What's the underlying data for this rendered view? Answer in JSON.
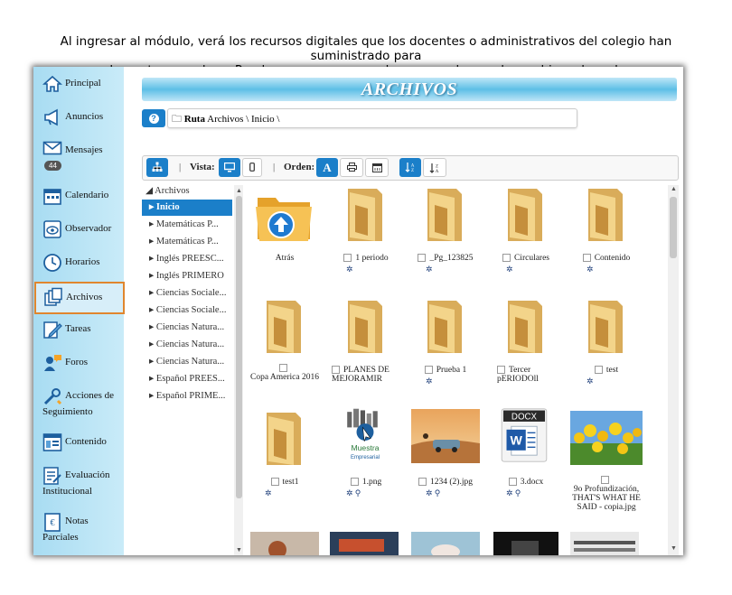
{
  "caption": {
    "line1": "Al ingresar al módulo, verá los recursos digitales que los docentes o administrativos del colegio han suministrado para",
    "line2": "complementar una clase. Puede navegar por sus clases, para buscar los archivos de cada una."
  },
  "sidebar": {
    "items": [
      {
        "label": "Principal",
        "icon": "home-icon"
      },
      {
        "label": "Anuncios",
        "icon": "megaphone-icon"
      },
      {
        "label": "Mensajes",
        "icon": "envelope-icon",
        "badge": "44"
      },
      {
        "label": "Calendario",
        "icon": "calendar-icon"
      },
      {
        "label": "Observador",
        "icon": "eye-icon"
      },
      {
        "label": "Horarios",
        "icon": "clock-icon"
      },
      {
        "label": "Archivos",
        "icon": "files-icon"
      },
      {
        "label": "Tareas",
        "icon": "pencil-icon"
      },
      {
        "label": "Foros",
        "icon": "forum-icon"
      },
      {
        "label": "Acciones de",
        "label2": "Seguimiento",
        "icon": "tools-icon"
      },
      {
        "label": "Contenido",
        "icon": "content-icon"
      },
      {
        "label": "Evaluación",
        "label2": "Institucional",
        "icon": "evaluation-icon"
      },
      {
        "label": "Notas",
        "label2": "Parciales",
        "icon": "grades-icon"
      }
    ]
  },
  "header": {
    "title": "ARCHIVOS"
  },
  "breadcrumb": {
    "label": "Ruta",
    "path": "Archivos \\ Inicio \\"
  },
  "toolbar": {
    "vista_label": "Vista:",
    "orden_label": "Orden:",
    "order_a": "A"
  },
  "tree": {
    "root": "Archivos",
    "items": [
      "Inicio",
      "Matemáticas P...",
      "Matemáticas P...",
      "Inglés PREESC...",
      "Inglés PRIMERO",
      "Ciencias Sociale...",
      "Ciencias Sociale...",
      "Ciencias Natura...",
      "Ciencias Natura...",
      "Ciencias Natura...",
      "Español PREES...",
      "Español PRIME..."
    ]
  },
  "files": [
    {
      "name": "Atrás",
      "kind": "back"
    },
    {
      "name": "1 periodo",
      "kind": "folder"
    },
    {
      "name": "_Pg_123825",
      "kind": "folder"
    },
    {
      "name": "Circulares",
      "kind": "folder"
    },
    {
      "name": "Contenido",
      "kind": "folder"
    },
    {
      "name": "Copa America 2016",
      "kind": "folder"
    },
    {
      "name": "PLANES DE MEJORAMIR",
      "kind": "folder"
    },
    {
      "name": "Prueba 1",
      "kind": "folder"
    },
    {
      "name": "Tercer pERIODOll",
      "kind": "folder"
    },
    {
      "name": "test",
      "kind": "folder"
    },
    {
      "name": "test1",
      "kind": "folder"
    },
    {
      "name": "1.png",
      "kind": "image-logo"
    },
    {
      "name": "1234 (2).jpg",
      "kind": "image-desert"
    },
    {
      "name": "3.docx",
      "kind": "docx"
    },
    {
      "name": "9o Profundización, THAT'S WHAT HE SAID - copia.jpg",
      "kind": "image-tulips"
    }
  ],
  "logo_text": {
    "line1": "Muestra",
    "line2": "Empresarial"
  },
  "docx_label": "DOCX",
  "colors": {
    "accent": "#1b7fc9",
    "sidebar": "#b8e3f5",
    "active_border": "#e0862e"
  }
}
